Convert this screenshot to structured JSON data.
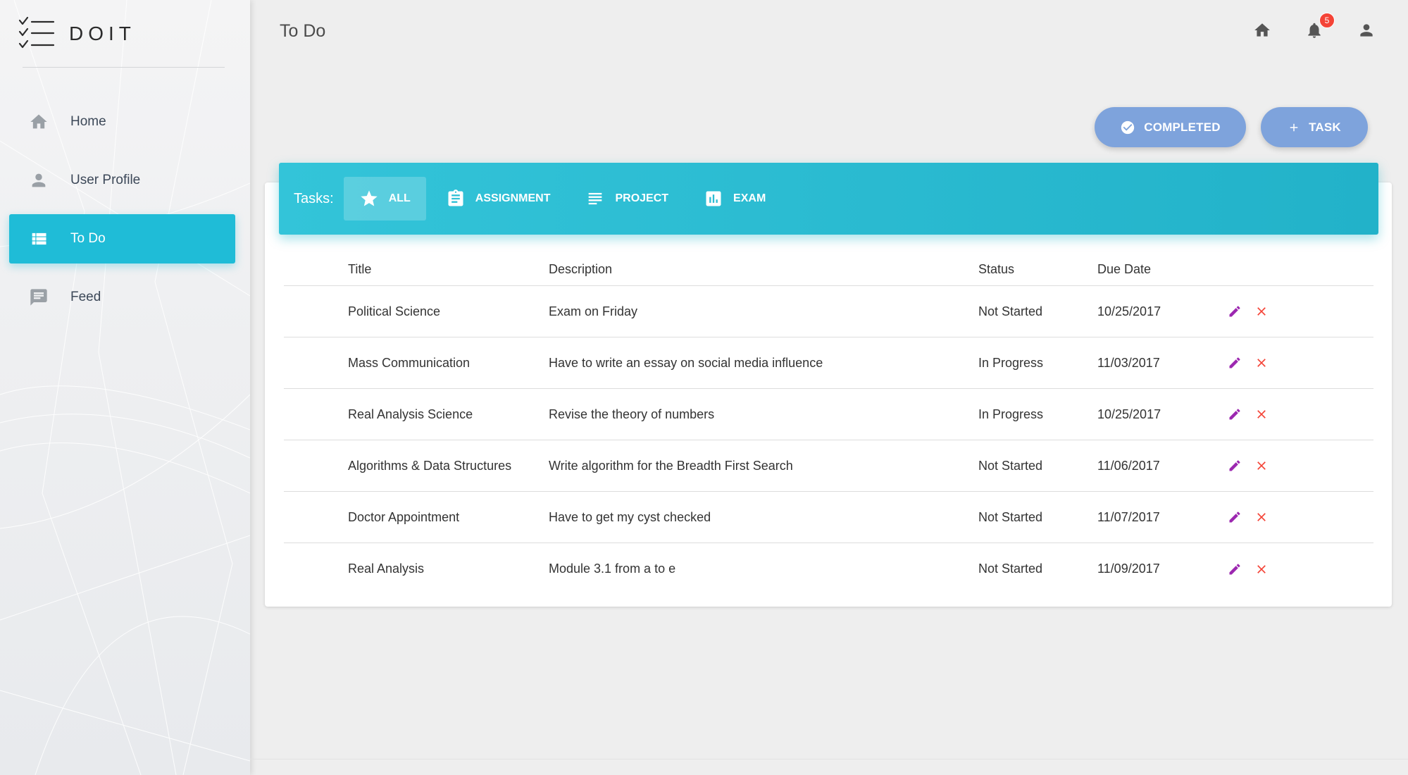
{
  "app": {
    "name": "DOIT"
  },
  "sidebar": {
    "items": [
      {
        "label": "Home",
        "icon": "home-icon",
        "active": false
      },
      {
        "label": "User Profile",
        "icon": "person-icon",
        "active": false
      },
      {
        "label": "To Do",
        "icon": "list-icon",
        "active": true
      },
      {
        "label": "Feed",
        "icon": "feed-icon",
        "active": false
      }
    ]
  },
  "header": {
    "title": "To Do",
    "notifications_count": "5"
  },
  "actions": {
    "completed_label": "COMPLETED",
    "task_label": "TASK"
  },
  "tasks_bar": {
    "label": "Tasks:",
    "tabs": [
      {
        "label": "ALL",
        "icon": "star-icon",
        "active": true
      },
      {
        "label": "ASSIGNMENT",
        "icon": "assignment-icon",
        "active": false
      },
      {
        "label": "PROJECT",
        "icon": "subject-icon",
        "active": false
      },
      {
        "label": "EXAM",
        "icon": "chart-icon",
        "active": false
      }
    ]
  },
  "table": {
    "columns": [
      "Title",
      "Description",
      "Status",
      "Due Date"
    ],
    "rows": [
      {
        "title": "Political Science",
        "description": "Exam on Friday",
        "status": "Not Started",
        "due": "10/25/2017"
      },
      {
        "title": "Mass Communication",
        "description": "Have to write an essay on social media influence",
        "status": "In Progress",
        "due": "11/03/2017"
      },
      {
        "title": "Real Analysis Science",
        "description": "Revise the theory of numbers",
        "status": "In Progress",
        "due": "10/25/2017"
      },
      {
        "title": "Algorithms & Data Structures",
        "description": "Write algorithm for the Breadth First Search",
        "status": "Not Started",
        "due": "11/06/2017"
      },
      {
        "title": "Doctor Appointment",
        "description": "Have to get my cyst checked",
        "status": "Not Started",
        "due": "11/07/2017"
      },
      {
        "title": "Real Analysis",
        "description": "Module 3.1 from a to e",
        "status": "Not Started",
        "due": "11/09/2017"
      }
    ]
  },
  "colors": {
    "accent": "#1fbcd7",
    "button": "#7ea3dc",
    "edit": "#9c27b0",
    "delete": "#f44336",
    "badge": "#f44336"
  }
}
